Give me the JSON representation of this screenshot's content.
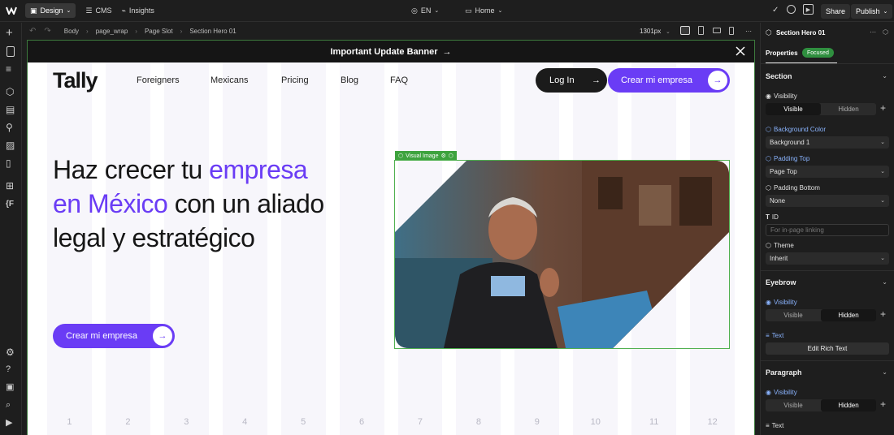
{
  "topbar": {
    "design_label": "Design",
    "cms_label": "CMS",
    "insights_label": "Insights",
    "locale_label": "EN",
    "page_label": "Home",
    "share_label": "Share",
    "publish_label": "Publish"
  },
  "breadcrumb": {
    "items": [
      "Body",
      "page_wrap",
      "Page Slot",
      "Section Hero 01"
    ],
    "width_label": "1301px"
  },
  "site": {
    "banner_text": "Important Update Banner",
    "logo": "Tally",
    "nav": [
      "Foreigners",
      "Mexicans",
      "Pricing",
      "Blog",
      "FAQ"
    ],
    "login_label": "Log In",
    "crear_label": "Crear mi empresa",
    "headline_part1": "Haz crecer tu ",
    "headline_accent1": "empresa",
    "headline_accent2": "en México",
    "headline_part2": " con un aliado",
    "headline_part3": "legal y estratégico",
    "cta_label": "Crear mi empresa",
    "visual_tag": "Visual Image",
    "column_numbers": [
      "1",
      "2",
      "3",
      "4",
      "5",
      "6",
      "7",
      "8",
      "9",
      "10",
      "11",
      "12"
    ]
  },
  "panel": {
    "element_name": "Section Hero 01",
    "tab_properties": "Properties",
    "focused_badge": "Focused",
    "section_title": "Section",
    "visibility_label": "Visibility",
    "visible_label": "Visible",
    "hidden_label": "Hidden",
    "bg_color_label": "Background Color",
    "bg_color_value": "Background 1",
    "padding_top_label": "Padding Top",
    "padding_top_value": "Page Top",
    "padding_bottom_label": "Padding Bottom",
    "padding_bottom_value": "None",
    "id_label": "ID",
    "id_placeholder": "For in-page linking",
    "theme_label": "Theme",
    "theme_value": "Inherit",
    "eyebrow_title": "Eyebrow",
    "eyebrow_visibility": "Visibility",
    "text_label": "Text",
    "edit_rich_text": "Edit Rich Text",
    "paragraph_title": "Paragraph",
    "paragraph_visibility": "Visibility",
    "paragraph_text_label": "Text"
  },
  "colors": {
    "accent": "#6a3cf5",
    "select_green": "#3ea33e",
    "focused_green": "#2f8f3f"
  }
}
